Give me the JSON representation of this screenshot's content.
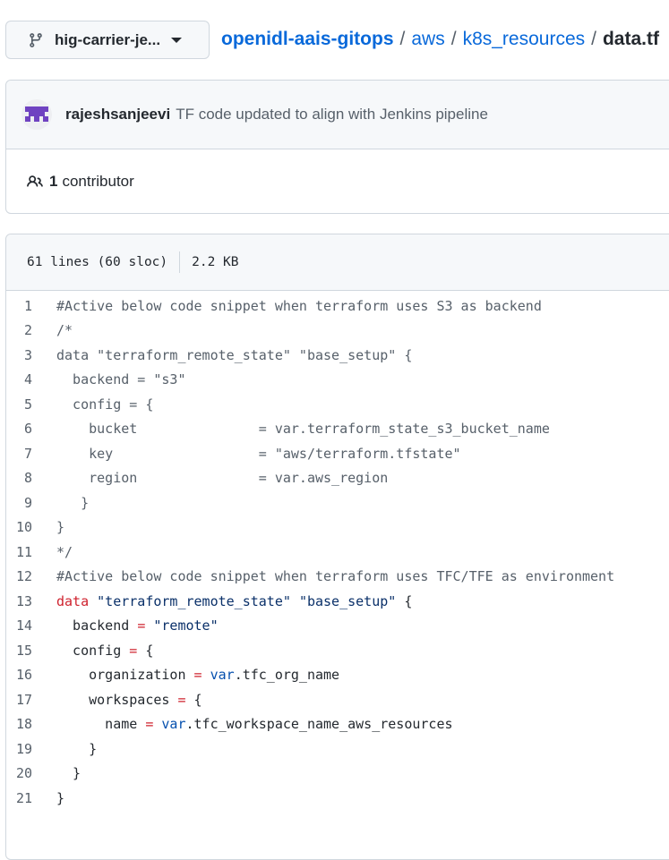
{
  "branch": {
    "label": "hig-carrier-je..."
  },
  "breadcrumb": {
    "repo": "openidl-aais-gitops",
    "sep": "/",
    "folder1": "aws",
    "folder2": "k8s_resources",
    "file": "data.tf"
  },
  "commit": {
    "author": "rajeshsanjeevi",
    "message": "TF code updated to align with Jenkins pipeline"
  },
  "contributors": {
    "count": "1",
    "label": "contributor"
  },
  "file_info": {
    "lines": "61 lines (60 sloc)",
    "size": "2.2 KB"
  },
  "code": [
    {
      "n": "1",
      "t": "#Active below code snippet when terraform uses S3 as backend"
    },
    {
      "n": "2",
      "t": "/*"
    },
    {
      "n": "3",
      "t": "data \"terraform_remote_state\" \"base_setup\" {"
    },
    {
      "n": "4",
      "t": "  backend = \"s3\""
    },
    {
      "n": "5",
      "t": "  config = {"
    },
    {
      "n": "6",
      "t": "    bucket               = var.terraform_state_s3_bucket_name"
    },
    {
      "n": "7",
      "t": "    key                  = \"aws/terraform.tfstate\""
    },
    {
      "n": "8",
      "t": "    region               = var.aws_region"
    },
    {
      "n": "9",
      "t": "   }"
    },
    {
      "n": "10",
      "t": "}"
    },
    {
      "n": "11",
      "t": "*/"
    },
    {
      "n": "12",
      "t": "#Active below code snippet when terraform uses TFC/TFE as environment"
    },
    {
      "n": "13",
      "p": [
        {
          "c": "kw",
          "t": "data"
        },
        {
          "c": "",
          "t": " "
        },
        {
          "c": "str",
          "t": "\"terraform_remote_state\""
        },
        {
          "c": "",
          "t": " "
        },
        {
          "c": "str",
          "t": "\"base_setup\""
        },
        {
          "c": "",
          "t": " {"
        }
      ]
    },
    {
      "n": "14",
      "p": [
        {
          "c": "",
          "t": "  backend "
        },
        {
          "c": "kw",
          "t": "="
        },
        {
          "c": "",
          "t": " "
        },
        {
          "c": "str",
          "t": "\"remote\""
        }
      ]
    },
    {
      "n": "15",
      "p": [
        {
          "c": "",
          "t": "  config "
        },
        {
          "c": "kw",
          "t": "="
        },
        {
          "c": "",
          "t": " {"
        }
      ]
    },
    {
      "n": "16",
      "p": [
        {
          "c": "",
          "t": "    organization "
        },
        {
          "c": "kw",
          "t": "="
        },
        {
          "c": "",
          "t": " "
        },
        {
          "c": "var",
          "t": "var"
        },
        {
          "c": "",
          "t": ".tfc_org_name"
        }
      ]
    },
    {
      "n": "17",
      "p": [
        {
          "c": "",
          "t": "    workspaces "
        },
        {
          "c": "kw",
          "t": "="
        },
        {
          "c": "",
          "t": " {"
        }
      ]
    },
    {
      "n": "18",
      "p": [
        {
          "c": "",
          "t": "      name "
        },
        {
          "c": "kw",
          "t": "="
        },
        {
          "c": "",
          "t": " "
        },
        {
          "c": "var",
          "t": "var"
        },
        {
          "c": "",
          "t": ".tfc_workspace_name_aws_resources"
        }
      ]
    },
    {
      "n": "19",
      "p": [
        {
          "c": "",
          "t": "    }"
        }
      ]
    },
    {
      "n": "20",
      "p": [
        {
          "c": "",
          "t": "  }"
        }
      ]
    },
    {
      "n": "21",
      "p": [
        {
          "c": "",
          "t": "}"
        }
      ]
    }
  ],
  "colors": {
    "link": "#0969da",
    "keyword": "#cf222e",
    "string": "#0a3069",
    "variable": "#0550ae",
    "comment": "#57606a",
    "avatar": "#6f42c1"
  },
  "icons": {
    "branch": "git-branch-icon",
    "caret": "triangle-down-icon",
    "avatar": "identicon-avatar",
    "people": "people-icon"
  }
}
